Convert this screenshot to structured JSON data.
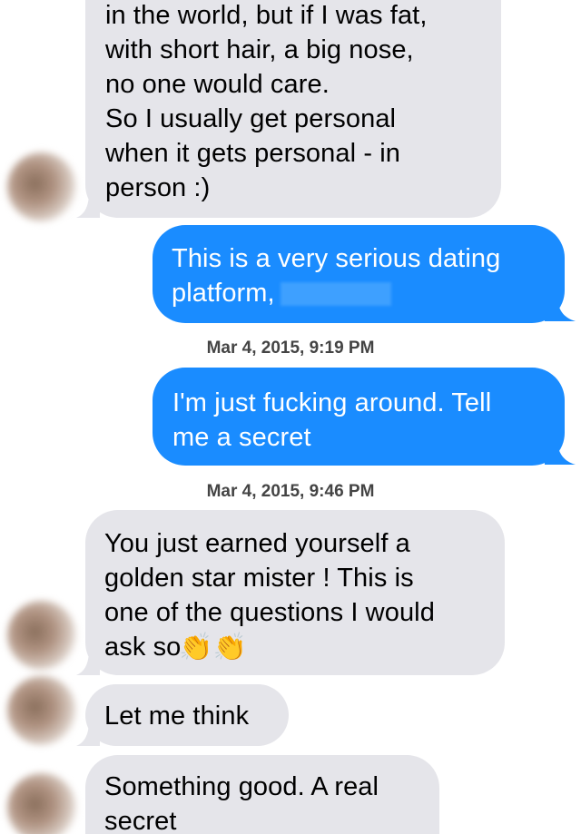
{
  "messages": [
    {
      "direction": "incoming",
      "lines": [
        "in the world, but if I was fat,",
        "with short hair, a big nose,",
        "no one would care.",
        "So I usually get personal",
        "when it gets personal - in",
        "person :)"
      ]
    },
    {
      "direction": "outgoing",
      "lines": [
        "This is a very serious dating",
        "platform,"
      ],
      "redacted": true
    },
    {
      "timestamp": {
        "date": "Mar 4, 2015,",
        "time": "9:19 PM"
      }
    },
    {
      "direction": "outgoing",
      "lines": [
        "I'm just fucking around. Tell",
        "me a secret"
      ]
    },
    {
      "timestamp": {
        "date": "Mar 4, 2015,",
        "time": "9:46 PM"
      }
    },
    {
      "direction": "incoming",
      "lines": [
        "You just earned yourself a",
        "golden star mister ! This is",
        "one of the questions I would",
        "ask so"
      ],
      "emoji": "👏👏"
    },
    {
      "direction": "incoming",
      "lines": [
        "Let me think"
      ]
    },
    {
      "direction": "incoming",
      "lines": [
        "Something good. A real",
        "secret"
      ]
    }
  ],
  "colors": {
    "incoming_bubble": "#e5e5ea",
    "outgoing_bubble": "#1a8cff",
    "timestamp_text": "#444444"
  }
}
